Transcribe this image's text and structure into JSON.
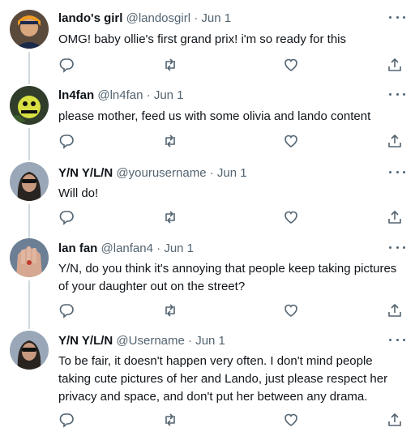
{
  "tweets": [
    {
      "display_name": "lando's girl",
      "handle": "@landosgirl",
      "sep": "·",
      "date": "Jun 1",
      "text": "OMG! baby ollie's first grand prix! i'm so ready for this"
    },
    {
      "display_name": "ln4fan",
      "handle": "@ln4fan",
      "sep": "·",
      "date": "Jun 1",
      "text": "please mother, feed us with some olivia and lando content"
    },
    {
      "display_name": "Y/N Y/L/N",
      "handle": "@yourusername",
      "sep": "·",
      "date": "Jun 1",
      "text": "Will do!"
    },
    {
      "display_name": "lan fan",
      "handle": "@lanfan4",
      "sep": "·",
      "date": "Jun 1",
      "text": "Y/N, do you think it's annoying that people keep taking pictures of your daughter out on the street?"
    },
    {
      "display_name": "Y/N Y/L/N",
      "handle": "@Username",
      "sep": "·",
      "date": "Jun 1",
      "text": "To be fair, it doesn't happen very often. I don't mind people taking cute pictures of her and Lando, just please respect her privacy and space, and don't put her between any drama."
    }
  ],
  "icons": {
    "reply": "reply-icon",
    "retweet": "retweet-icon",
    "like": "like-icon",
    "share": "share-icon",
    "more": "more-icon"
  },
  "colors": {
    "text": "#0f1419",
    "secondary": "#536471",
    "thread_line": "#cfd9de"
  }
}
